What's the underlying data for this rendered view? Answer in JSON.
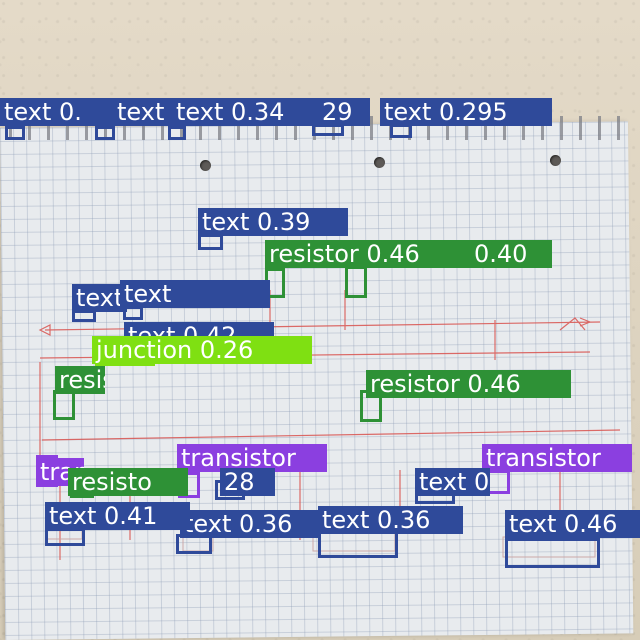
{
  "colors": {
    "text": "#2f4a9a",
    "resistor": "#2e9136",
    "transistor": "#8b3fe0",
    "junction": "#7fe012"
  },
  "detections": [
    {
      "label": "text 0.",
      "cls": "text"
    },
    {
      "label": "text",
      "cls": "text"
    },
    {
      "label": "text 0.34",
      "cls": "text"
    },
    {
      "label": "29",
      "cls": "text"
    },
    {
      "label": "text 0.295",
      "cls": "text"
    },
    {
      "label": "text 0.39",
      "cls": "text"
    },
    {
      "label": "resistor 0.46",
      "cls": "resistor"
    },
    {
      "label": "0.40",
      "cls": "resistor"
    },
    {
      "label": "text 0.43",
      "cls": "text"
    },
    {
      "label": "text",
      "cls": "text"
    },
    {
      "label": "text 0.42",
      "cls": "text"
    },
    {
      "label": "junction 0.26",
      "cls": "junction"
    },
    {
      "label": "resistor 0.54",
      "cls": "resistor"
    },
    {
      "label": "resistor 0.46",
      "cls": "resistor"
    },
    {
      "label": "transistor 0.69",
      "cls": "transistor"
    },
    {
      "label": "transistor",
      "cls": "transistor"
    },
    {
      "label": "transistor",
      "cls": "transistor"
    },
    {
      "label": "resisto",
      "cls": "resistor"
    },
    {
      "label": "28",
      "cls": "text"
    },
    {
      "label": "text 0.36",
      "cls": "text"
    },
    {
      "label": "text 0.41",
      "cls": "text"
    },
    {
      "label": "text 0.36",
      "cls": "text"
    },
    {
      "label": "text 0.46",
      "cls": "text"
    },
    {
      "label": "text 0.5",
      "cls": "text"
    }
  ]
}
